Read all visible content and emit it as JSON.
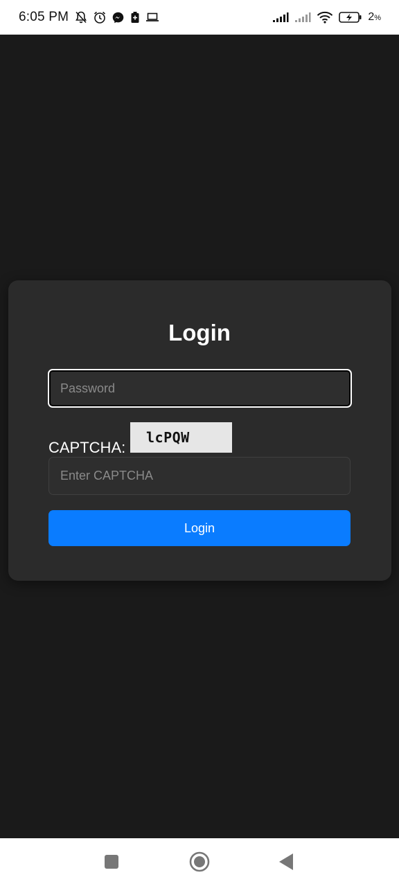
{
  "status_bar": {
    "time": "6:05 PM",
    "battery_percent": "2",
    "battery_unit": "%",
    "icons_left": [
      "bell-off-icon",
      "alarm-icon",
      "messenger-icon",
      "battery-saver-icon",
      "laptop-icon"
    ],
    "icons_right": [
      "signal-icon",
      "signal-icon",
      "wifi-icon",
      "battery-charging-icon"
    ]
  },
  "login": {
    "title": "Login",
    "password_placeholder": "Password",
    "captcha_label": "CAPTCHA:",
    "captcha_code": "lcPQW",
    "captcha_placeholder": "Enter CAPTCHA",
    "button_label": "Login"
  },
  "nav_bar": {
    "icons": [
      "recents-icon",
      "home-icon",
      "back-icon"
    ]
  },
  "colors": {
    "background": "#1a1a1a",
    "card": "#2b2b2b",
    "accent": "#0a7cff"
  }
}
